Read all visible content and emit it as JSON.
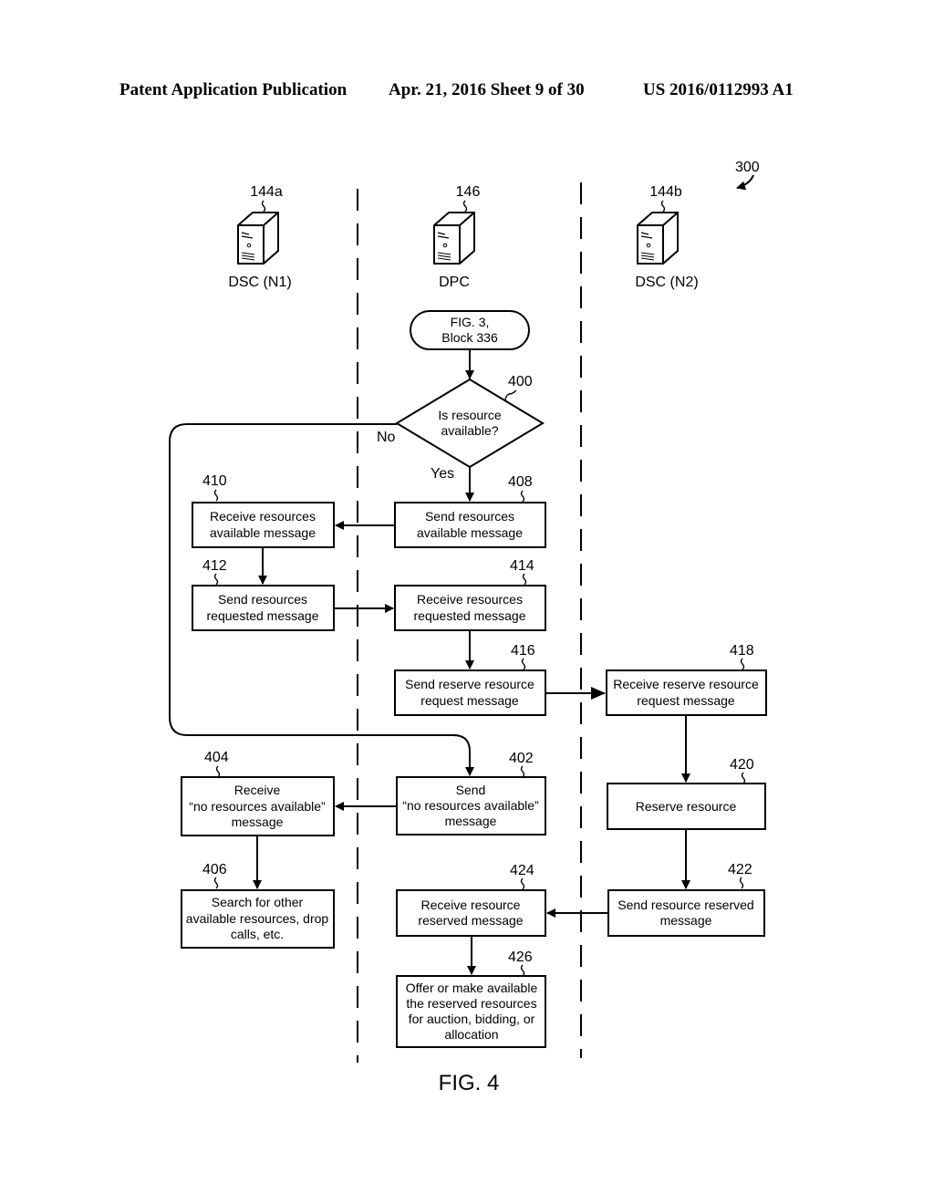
{
  "header": {
    "publication": "Patent Application Publication",
    "date_sheet": "Apr. 21, 2016  Sheet 9 of 30",
    "patent_number": "US 2016/0112993 A1"
  },
  "figure": {
    "ref_number": "300",
    "caption": "FIG. 4"
  },
  "lanes": [
    {
      "ref": "144a",
      "label": "DSC (N1)",
      "icon": "server-icon"
    },
    {
      "ref": "146",
      "label": "DPC",
      "icon": "server-icon"
    },
    {
      "ref": "144b",
      "label": "DSC (N2)",
      "icon": "server-icon"
    }
  ],
  "start": {
    "lines": [
      "FIG. 3,",
      "Block 336"
    ]
  },
  "decision": {
    "ref": "400",
    "lines": [
      "Is resource",
      "available?"
    ],
    "no_label": "No",
    "yes_label": "Yes"
  },
  "blocks": {
    "b408": {
      "ref": "408",
      "lines": [
        "Send resources",
        "available message"
      ]
    },
    "b410": {
      "ref": "410",
      "lines": [
        "Receive resources",
        "available message"
      ]
    },
    "b412": {
      "ref": "412",
      "lines": [
        "Send resources",
        "requested message"
      ]
    },
    "b414": {
      "ref": "414",
      "lines": [
        "Receive resources",
        "requested message"
      ]
    },
    "b416": {
      "ref": "416",
      "lines": [
        "Send reserve resource",
        "request message"
      ]
    },
    "b418": {
      "ref": "418",
      "lines": [
        "Receive reserve resource",
        "request message"
      ]
    },
    "b402": {
      "ref": "402",
      "lines": [
        "Send",
        "“no resources available”",
        "message"
      ]
    },
    "b404": {
      "ref": "404",
      "lines": [
        "Receive",
        "“no resources available”",
        "message"
      ]
    },
    "b406": {
      "ref": "406",
      "lines": [
        "Search for other",
        "available resources, drop",
        "calls, etc."
      ]
    },
    "b420": {
      "ref": "420",
      "lines": [
        "Reserve resource"
      ]
    },
    "b422": {
      "ref": "422",
      "lines": [
        "Send resource reserved",
        "message"
      ]
    },
    "b424": {
      "ref": "424",
      "lines": [
        "Receive resource",
        "reserved message"
      ]
    },
    "b426": {
      "ref": "426",
      "lines": [
        "Offer or make available",
        "the reserved resources",
        "for auction, bidding, or",
        "allocation"
      ]
    }
  }
}
